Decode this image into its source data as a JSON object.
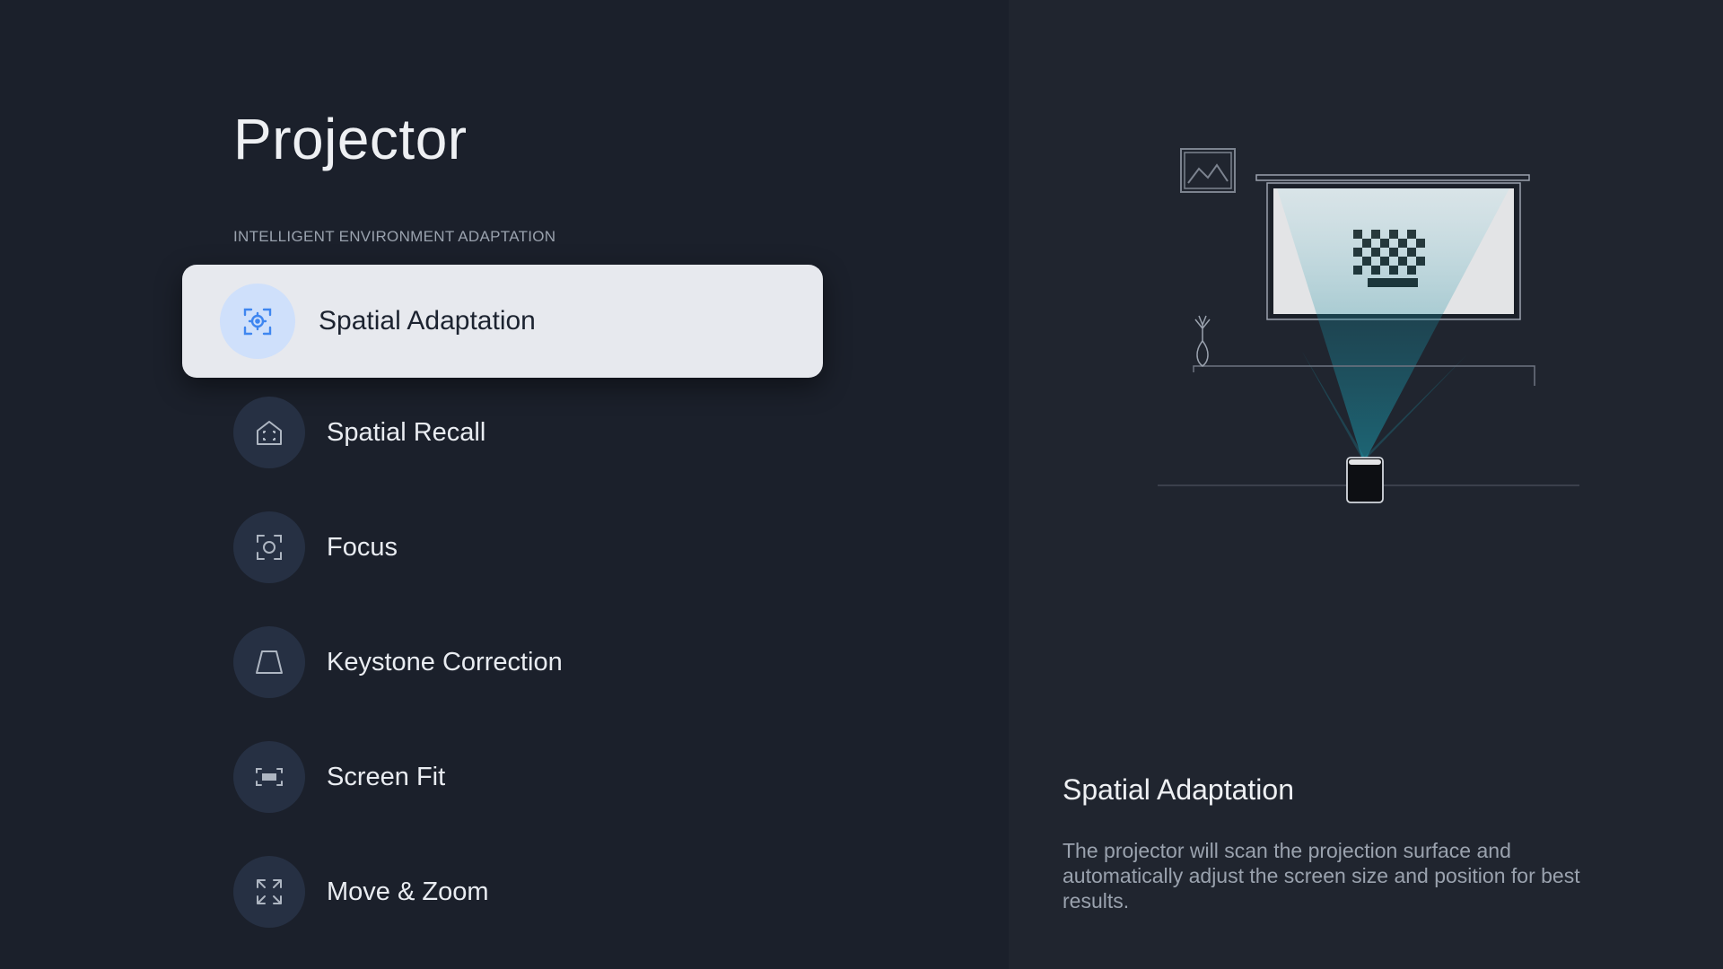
{
  "page": {
    "title": "Projector",
    "section_label": "INTELLIGENT ENVIRONMENT ADAPTATION"
  },
  "menu": {
    "items": [
      {
        "label": "Spatial Adaptation",
        "icon": "scan-target-icon",
        "selected": true
      },
      {
        "label": "Spatial Recall",
        "icon": "home-scan-icon",
        "selected": false
      },
      {
        "label": "Focus",
        "icon": "focus-icon",
        "selected": false
      },
      {
        "label": "Keystone Correction",
        "icon": "keystone-icon",
        "selected": false
      },
      {
        "label": "Screen Fit",
        "icon": "screen-fit-icon",
        "selected": false
      },
      {
        "label": "Move & Zoom",
        "icon": "expand-icon",
        "selected": false
      }
    ]
  },
  "detail": {
    "title": "Spatial Adaptation",
    "description": "The projector will scan the projection surface and automatically adjust the screen size and position for best results."
  },
  "colors": {
    "background": "#1b202b",
    "panel": "#20252f",
    "selected_bg": "#e7e9ee",
    "accent": "#3f86f0",
    "beam": "#1a9fb3"
  }
}
